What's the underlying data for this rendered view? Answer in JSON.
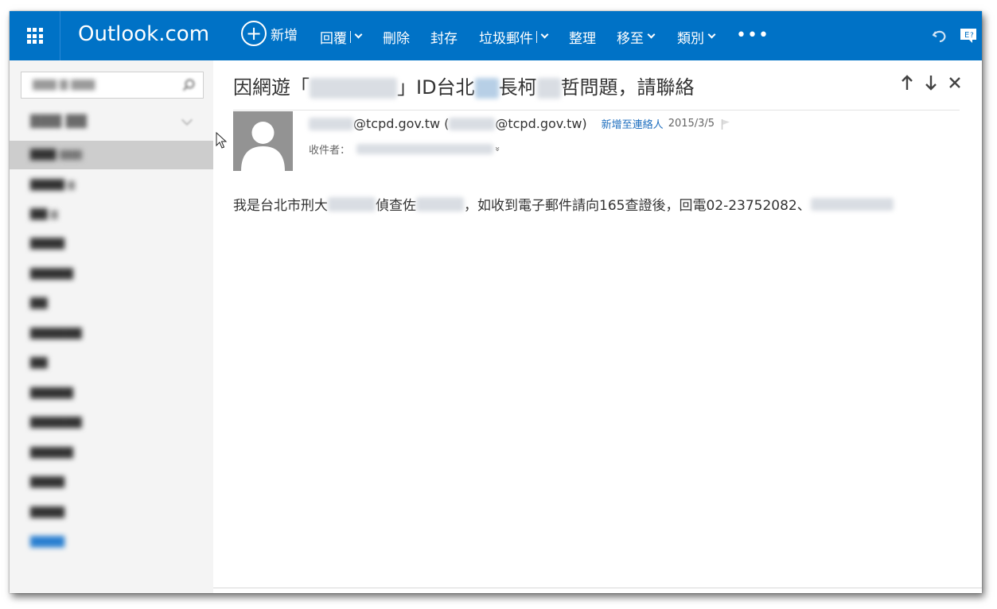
{
  "brand": {
    "title": "Outlook.com",
    "color": "#0072c6"
  },
  "toolbar": {
    "new_label": "新增",
    "reply_label": "回覆",
    "delete_label": "刪除",
    "archive_label": "封存",
    "junk_label": "垃圾郵件",
    "sweep_label": "整理",
    "move_label": "移至",
    "categories_label": "類別",
    "more_label": "•••"
  },
  "icons": {
    "app_launcher": "grid-icon",
    "new": "plus-circle-icon",
    "undo": "undo-icon",
    "feedback": "feedback-icon",
    "search": "search-icon",
    "up": "arrow-up-icon",
    "down": "arrow-down-icon",
    "close": "close-icon",
    "flag": "flag-icon",
    "expand": "expand-icon"
  },
  "message": {
    "subject_prefix": "因網遊「",
    "subject_mid1": "」ID台北",
    "subject_mid2": "長柯",
    "subject_suffix": "哲問題，請聯絡",
    "sender_domain": "@tcpd.gov.tw",
    "sender_paren_open": "(",
    "sender_email_domain": "@tcpd.gov.tw)",
    "add_contact": "新增至連絡人",
    "date": "2015/3/5",
    "to_label": "收件者：",
    "expand_glyph": "»",
    "body_part1": "我是台北市刑大",
    "body_part2": "偵查佐",
    "body_part3": "，如收到電子郵件請向165查證後，回電02-23752082、"
  }
}
